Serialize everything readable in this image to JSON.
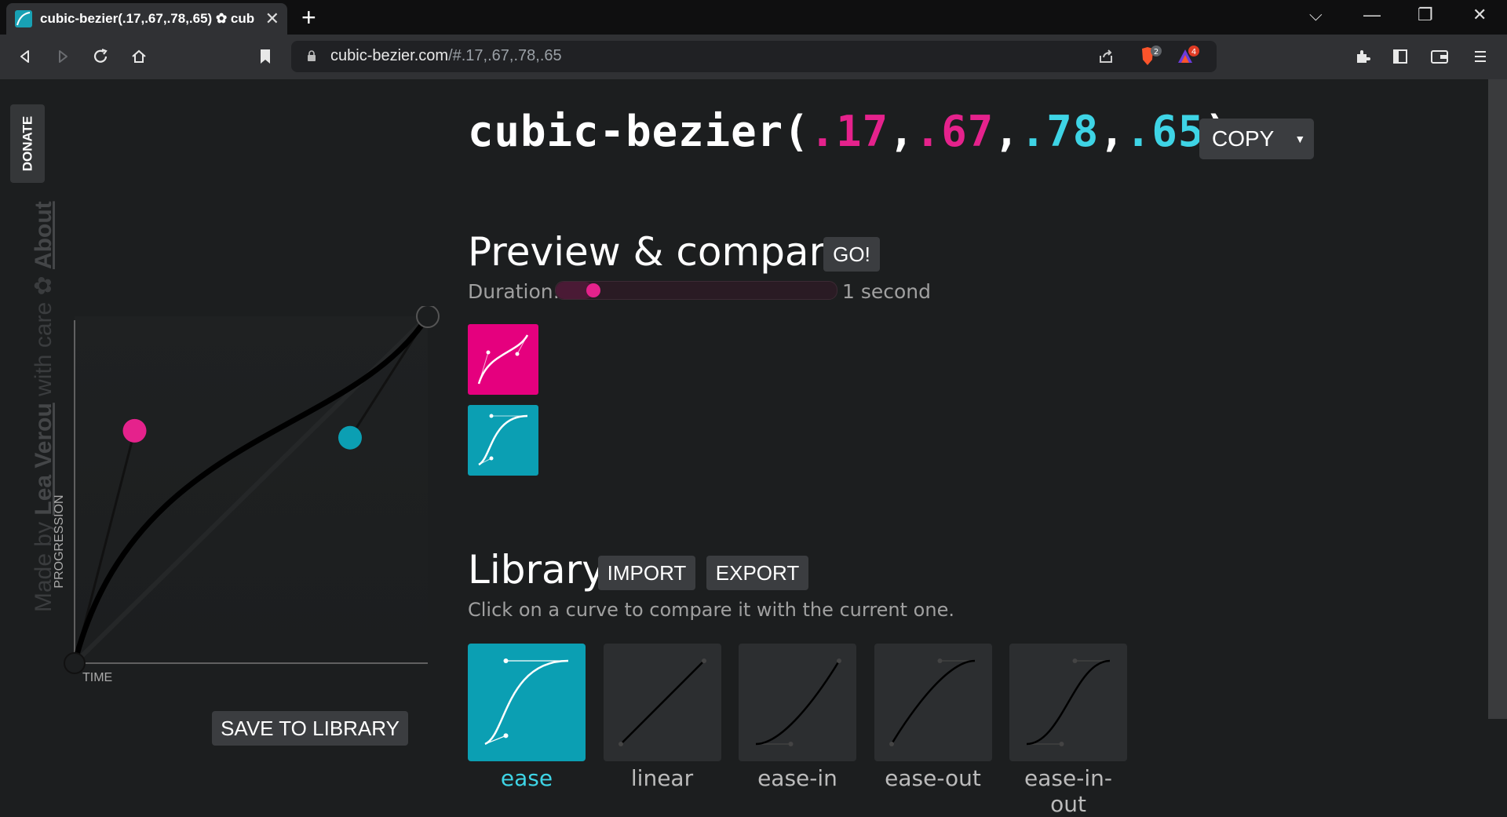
{
  "browser": {
    "tab_title": "cubic-bezier(.17,.67,.78,.65) ✿ cub",
    "new_tab": "+",
    "url_host": "cubic-bezier.com",
    "url_rest": "/#.17,.67,.78,.65",
    "brave_badge": "2",
    "rewards_badge": "4"
  },
  "sidebar": {
    "donate": "DONATE",
    "made_by_prefix": "Made by ",
    "author": "Lea Verou",
    "made_by_suffix": " with care ✿ ",
    "about": "About"
  },
  "editor": {
    "y_axis_label": "PROGRESSION",
    "x_axis_label": "TIME",
    "save_button": "SAVE TO LIBRARY",
    "p1": [
      0.17,
      0.67
    ],
    "p2": [
      0.78,
      0.65
    ],
    "p1_color": "#e5228c",
    "p2_color": "#0b9fb3"
  },
  "header": {
    "fn": "cubic-bezier(",
    "v1": ".17",
    "c1": ",",
    "v2": ".67",
    "c2": ",",
    "v3": ".78",
    "c3": ",",
    "v4": ".65",
    "close": ")",
    "copy_button": "COPY",
    "copy_caret": "▼"
  },
  "preview": {
    "heading": "Preview & compare",
    "go_button": "GO!",
    "duration_label": "Duration:",
    "duration_value": "1 second",
    "duration_fraction": 0.05,
    "box1_color": "#e5007e",
    "box2_color": "#0b9fb3"
  },
  "library": {
    "heading": "Library",
    "import_button": "IMPORT",
    "export_button": "EXPORT",
    "description": "Click on a curve to compare it with the current one.",
    "items": [
      {
        "label": "ease",
        "curve": [
          0.25,
          0.1,
          0.25,
          1
        ],
        "active": true
      },
      {
        "label": "linear",
        "curve": [
          0,
          0,
          1,
          1
        ],
        "active": false
      },
      {
        "label": "ease-in",
        "curve": [
          0.42,
          0,
          1,
          1
        ],
        "active": false
      },
      {
        "label": "ease-out",
        "curve": [
          0,
          0,
          0.58,
          1
        ],
        "active": false
      },
      {
        "label": "ease-in-out",
        "curve": [
          0.42,
          0,
          0.58,
          1
        ],
        "active": false
      }
    ]
  }
}
